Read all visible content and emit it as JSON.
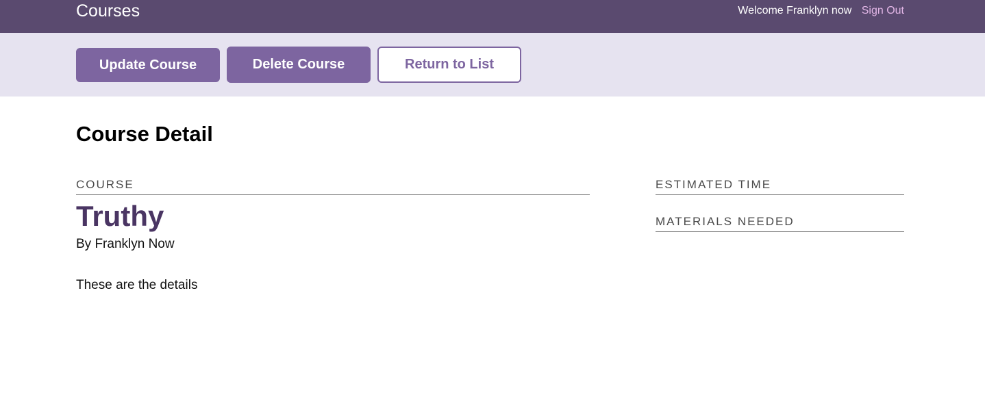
{
  "header": {
    "app_title": "Courses",
    "welcome_text": "Welcome Franklyn now",
    "signout_label": "Sign Out"
  },
  "actions": {
    "update_label": "Update Course",
    "delete_label": "Delete Course",
    "return_label": "Return to List"
  },
  "main": {
    "page_title": "Course Detail",
    "course_section_label": "COURSE",
    "course_title": "Truthy",
    "byline": "By Franklyn Now",
    "description": "These are the details",
    "estimated_time_label": "ESTIMATED TIME",
    "materials_label": "MATERIALS NEEDED"
  },
  "colors": {
    "header_bg": "#5a4a6f",
    "actions_bg": "#e6e3f0",
    "button_primary": "#7d65a0",
    "course_title": "#4a3563",
    "signout_link": "#e2b6e6"
  }
}
